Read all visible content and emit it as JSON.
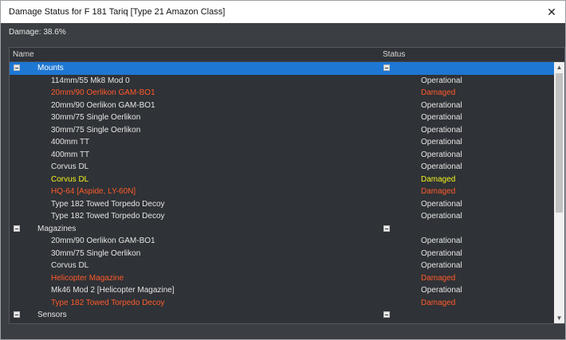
{
  "window": {
    "title": "Damage Status for F 181 Tariq [Type 21 Amazon Class]"
  },
  "summary": {
    "damage": "Damage: 38.6%"
  },
  "columns": {
    "name": "Name",
    "status": "Status"
  },
  "icons": {
    "close": "close-icon",
    "toggle": "collapse-minus-icon"
  },
  "colors": {
    "damaged": "#ff5a2b",
    "warning": "#f2f21f",
    "selected": "#1e77d3"
  },
  "rows": [
    {
      "type": "group",
      "label": "Mounts",
      "status": "",
      "style": "normal"
    },
    {
      "type": "item",
      "label": "114mm/55 Mk8 Mod 0",
      "status": "Operational",
      "style": "normal"
    },
    {
      "type": "item",
      "label": "20mm/90 Oerlikon GAM-BO1",
      "status": "Damaged",
      "style": "red"
    },
    {
      "type": "item",
      "label": "20mm/90 Oerlikon GAM-BO1",
      "status": "Operational",
      "style": "normal"
    },
    {
      "type": "item",
      "label": "30mm/75 Single Oerlikon",
      "status": "Operational",
      "style": "normal"
    },
    {
      "type": "item",
      "label": "30mm/75 Single Oerlikon",
      "status": "Operational",
      "style": "normal"
    },
    {
      "type": "item",
      "label": "400mm TT",
      "status": "Operational",
      "style": "normal"
    },
    {
      "type": "item",
      "label": "400mm TT",
      "status": "Operational",
      "style": "normal"
    },
    {
      "type": "item",
      "label": "Corvus DL",
      "status": "Operational",
      "style": "normal"
    },
    {
      "type": "item",
      "label": "Corvus DL",
      "status": "Damaged",
      "style": "yellow"
    },
    {
      "type": "item",
      "label": "HQ-64 [Aspide, LY-60N]",
      "status": "Damaged",
      "style": "red"
    },
    {
      "type": "item",
      "label": "Type 182 Towed Torpedo Decoy",
      "status": "Operational",
      "style": "normal"
    },
    {
      "type": "item",
      "label": "Type 182 Towed Torpedo Decoy",
      "status": "Operational",
      "style": "normal"
    },
    {
      "type": "group",
      "label": "Magazines",
      "status": "",
      "style": "normal"
    },
    {
      "type": "item",
      "label": "20mm/90 Oerlikon GAM-BO1",
      "status": "Operational",
      "style": "normal"
    },
    {
      "type": "item",
      "label": "30mm/75 Single Oerlikon",
      "status": "Operational",
      "style": "normal"
    },
    {
      "type": "item",
      "label": "Corvus DL",
      "status": "Operational",
      "style": "normal"
    },
    {
      "type": "item",
      "label": "Helicopter Magazine",
      "status": "Damaged",
      "style": "red"
    },
    {
      "type": "item",
      "label": "Mk46 Mod 2 [Helicopter Magazine]",
      "status": "Operational",
      "style": "normal"
    },
    {
      "type": "item",
      "label": "Type 182 Towed Torpedo Decoy",
      "status": "Damaged",
      "style": "red"
    },
    {
      "type": "group",
      "label": "Sensors",
      "status": "",
      "style": "normal"
    }
  ]
}
